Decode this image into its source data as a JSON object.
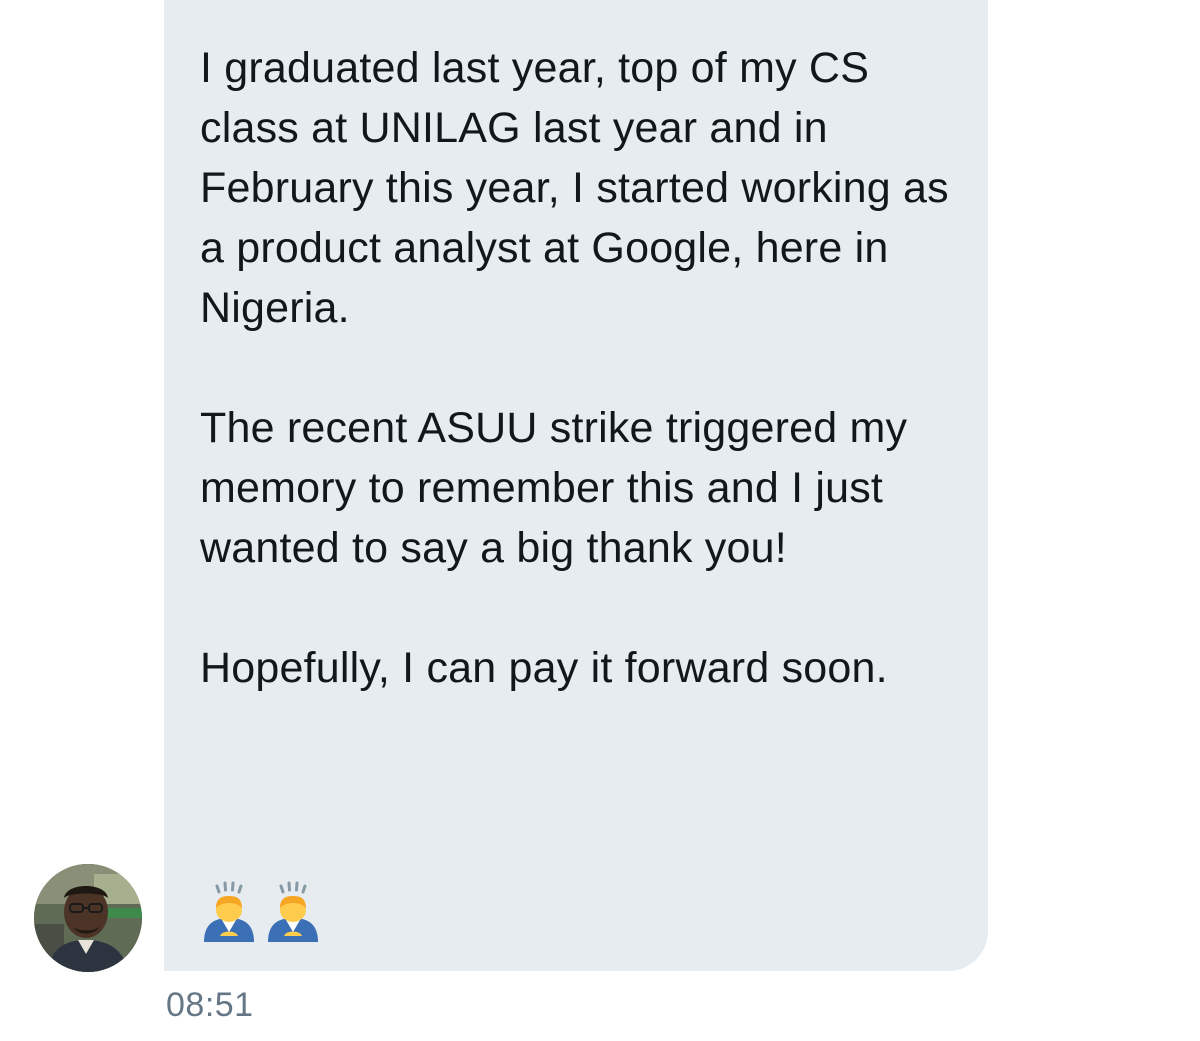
{
  "message": {
    "paragraphs": [
      "I graduated last year, top of my CS class at UNILAG last year and in February this year, I started working as a product analyst at Google, here in Nigeria.",
      "The recent ASUU strike triggered my memory to remember this and I just wanted to say a big thank you!",
      "Hopefully, I can pay it forward soon."
    ],
    "emojis": [
      "person-bowing-icon",
      "person-bowing-icon"
    ],
    "timestamp": "08:51"
  },
  "colors": {
    "bubble": "#e6ecf0",
    "text": "#14171a",
    "timestamp": "#657786"
  }
}
